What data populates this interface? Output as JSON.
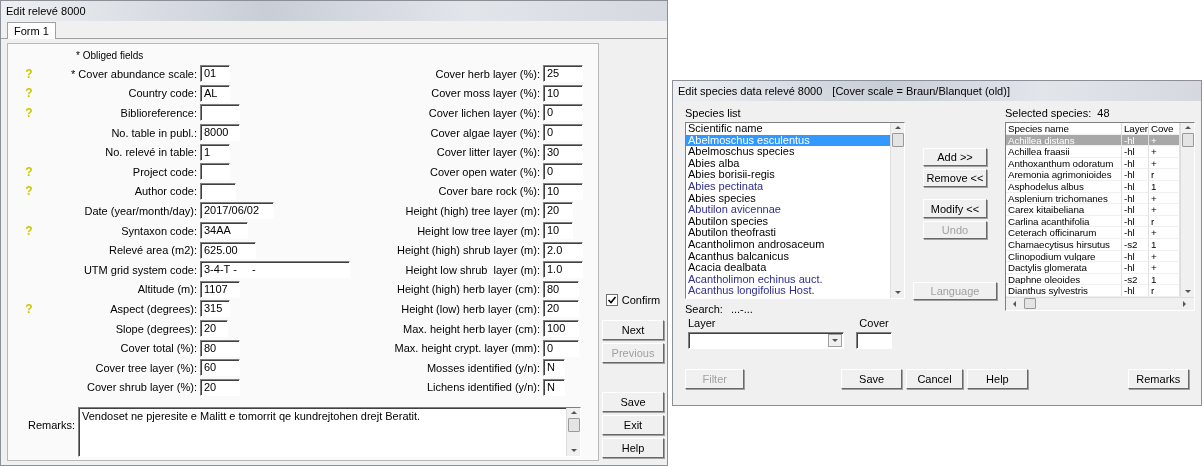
{
  "window": {
    "title": "Edit relevé 8000"
  },
  "tabs": [
    {
      "label": "Form 1",
      "selected": true
    }
  ],
  "note": "* Obliged fields",
  "help_glyph": "?",
  "fields_left": [
    {
      "label": "* Cover abundance scale:",
      "value": "01",
      "help": true
    },
    {
      "label": "Country code:",
      "value": "AL",
      "help": true
    },
    {
      "label": "Biblioreference:",
      "help": true
    },
    {
      "label": "No. table in publ.:",
      "value": "8000",
      "help": false
    },
    {
      "label": "No. relevé in table:",
      "value": "1",
      "help": false
    },
    {
      "label": "Project code:",
      "help": true
    },
    {
      "label": "Author code:",
      "help": true
    },
    {
      "label": "Date (year/month/day):",
      "value": "2017/06/02",
      "help": false
    },
    {
      "label": "Syntaxon code:",
      "value": "34AA",
      "help": true
    },
    {
      "label": "Relevé area (m2):",
      "value": "625.00",
      "help": false
    },
    {
      "label": "UTM grid system code:",
      "value": "3-4-T -     -",
      "help": false
    },
    {
      "label": "Altitude (m):",
      "value": "1107",
      "help": false
    },
    {
      "label": "Aspect (degrees):",
      "value": "315",
      "help": true
    },
    {
      "label": "Slope (degrees):",
      "value": "20",
      "help": false
    },
    {
      "label": "Cover total (%):",
      "value": "80",
      "help": false
    },
    {
      "label": "Cover tree layer (%):",
      "value": "60",
      "help": false
    },
    {
      "label": "Cover shrub layer (%):",
      "value": "20",
      "help": false
    }
  ],
  "fields_right": [
    {
      "label": "Cover herb layer (%):",
      "value": "25"
    },
    {
      "label": "Cover moss layer (%):",
      "value": "10"
    },
    {
      "label": "Cover lichen layer (%):",
      "value": "0"
    },
    {
      "label": "Cover algae layer (%):",
      "value": "0"
    },
    {
      "label": "Cover litter layer (%):",
      "value": "30"
    },
    {
      "label": "Cover open water (%):",
      "value": "0"
    },
    {
      "label": "Cover bare rock (%):",
      "value": "10"
    },
    {
      "label": "Height (high) tree layer (m):",
      "value": "20"
    },
    {
      "label": "Height low tree layer (m):",
      "value": "10"
    },
    {
      "label": "Height (high) shrub layer (m):",
      "value": "2.0"
    },
    {
      "label": "Height low shrub  layer (m):",
      "value": "1.0"
    },
    {
      "label": "Height (high) herb layer (cm):",
      "value": "80"
    },
    {
      "label": "Height (low) herb layer (cm):",
      "value": "20"
    },
    {
      "label": "Max. height herb layer (cm):",
      "value": "100"
    },
    {
      "label": "Max. height crypt. layer (mm):",
      "value": "0"
    },
    {
      "label": "Mosses identified (y/n):",
      "value": "N"
    },
    {
      "label": "Lichens identified (y/n):",
      "value": "N"
    }
  ],
  "remarks": {
    "label": "Remarks:",
    "value": "Vendoset ne pjeresite e Malitt e tomorrit qe kundrejtohen drejt Beratit."
  },
  "confirm": {
    "label": "Confirm",
    "checked": true
  },
  "buttons": [
    {
      "label": "Next",
      "disabled": false
    },
    {
      "label": "Previous",
      "disabled": true
    },
    {
      "label": "Save",
      "disabled": false
    },
    {
      "label": "Exit",
      "disabled": false
    },
    {
      "label": "Help",
      "disabled": false
    }
  ],
  "species_dialog": {
    "title": "Edit species data relevé 8000",
    "subtitle": "[Cover scale = Braun/Blanquet (old)]",
    "species_list": {
      "label": "Species list",
      "column": "Scientific name",
      "items": [
        {
          "name": "Abelmoschus esculentus",
          "selected": true
        },
        {
          "name": "Abelmoschus species",
          "selected": false,
          "color": "#000000"
        },
        {
          "name": "Abies alba",
          "selected": false,
          "color": "#000000"
        },
        {
          "name": "Abies borisii-regis",
          "selected": false,
          "color": "#000000"
        },
        {
          "name": "Abies pectinata",
          "selected": false,
          "color": "#2e2e8c"
        },
        {
          "name": "Abies species",
          "selected": false,
          "color": "#000000"
        },
        {
          "name": "Abutilon avicennae",
          "selected": false,
          "color": "#2e2e8c"
        },
        {
          "name": "Abutilon species",
          "selected": false,
          "color": "#000000"
        },
        {
          "name": "Abutilon theofrasti",
          "selected": false,
          "color": "#000000"
        },
        {
          "name": "Acantholimon androsaceum",
          "selected": false,
          "color": "#000000"
        },
        {
          "name": "Acanthus balcanicus",
          "selected": false,
          "color": "#000000"
        },
        {
          "name": "Acacia dealbata",
          "selected": false,
          "color": "#000000"
        },
        {
          "name": "Acantholimon echinus auct.",
          "selected": false,
          "color": "#2e2e8c"
        },
        {
          "name": "Acanthus longifolius Host.",
          "selected": false,
          "color": "#2e2e8c"
        }
      ]
    },
    "selected_species": {
      "label": "Selected species:",
      "count": "48",
      "columns": [
        "Species name",
        "Layer",
        "Cove"
      ],
      "rows": [
        {
          "name": "Achillea distans",
          "layer": "-hl",
          "cover": "+",
          "selected": true
        },
        {
          "name": "Achillea fraasii",
          "layer": "-hl",
          "cover": "+",
          "selected": false
        },
        {
          "name": "Anthoxanthum odoratum",
          "layer": "-hl",
          "cover": "+",
          "selected": false
        },
        {
          "name": "Aremonia agrimonioides",
          "layer": "-hl",
          "cover": "r",
          "selected": false
        },
        {
          "name": "Asphodelus albus",
          "layer": "-hl",
          "cover": "1",
          "selected": false
        },
        {
          "name": "Asplenium trichomanes",
          "layer": "-hl",
          "cover": "+",
          "selected": false
        },
        {
          "name": "Carex kitaibeliana",
          "layer": "-hl",
          "cover": "+",
          "selected": false
        },
        {
          "name": "Carlina acanthifolia",
          "layer": "-hl",
          "cover": "r",
          "selected": false
        },
        {
          "name": "Ceterach officinarum",
          "layer": "-hl",
          "cover": "+",
          "selected": false
        },
        {
          "name": "Chamaecytisus hirsutus",
          "layer": "-s2",
          "cover": "1",
          "selected": false
        },
        {
          "name": "Clinopodium vulgare",
          "layer": "-hl",
          "cover": "+",
          "selected": false
        },
        {
          "name": "Dactylis glomerata",
          "layer": "-hl",
          "cover": "+",
          "selected": false
        },
        {
          "name": "Daphne oleoides",
          "layer": "-s2",
          "cover": "1",
          "selected": false
        },
        {
          "name": "Dianthus sylvestris",
          "layer": "-hl",
          "cover": "r",
          "selected": false
        }
      ]
    },
    "action_buttons": [
      {
        "label": "Add >>",
        "disabled": false
      },
      {
        "label": "Remove <<",
        "disabled": false
      },
      {
        "label": "Modify <<",
        "disabled": false
      },
      {
        "label": "Undo",
        "disabled": true
      }
    ],
    "language_button": {
      "label": "Language",
      "disabled": true
    },
    "search": {
      "label": "Search:",
      "value": "...-..."
    },
    "layer": {
      "label": "Layer"
    },
    "cover": {
      "label": "Cover"
    },
    "bottom_buttons": [
      {
        "label": "Filter",
        "disabled": true
      },
      {
        "label": "Save",
        "disabled": false
      },
      {
        "label": "Cancel",
        "disabled": false
      },
      {
        "label": "Help",
        "disabled": false
      },
      {
        "label": "Remarks",
        "disabled": false
      }
    ]
  }
}
